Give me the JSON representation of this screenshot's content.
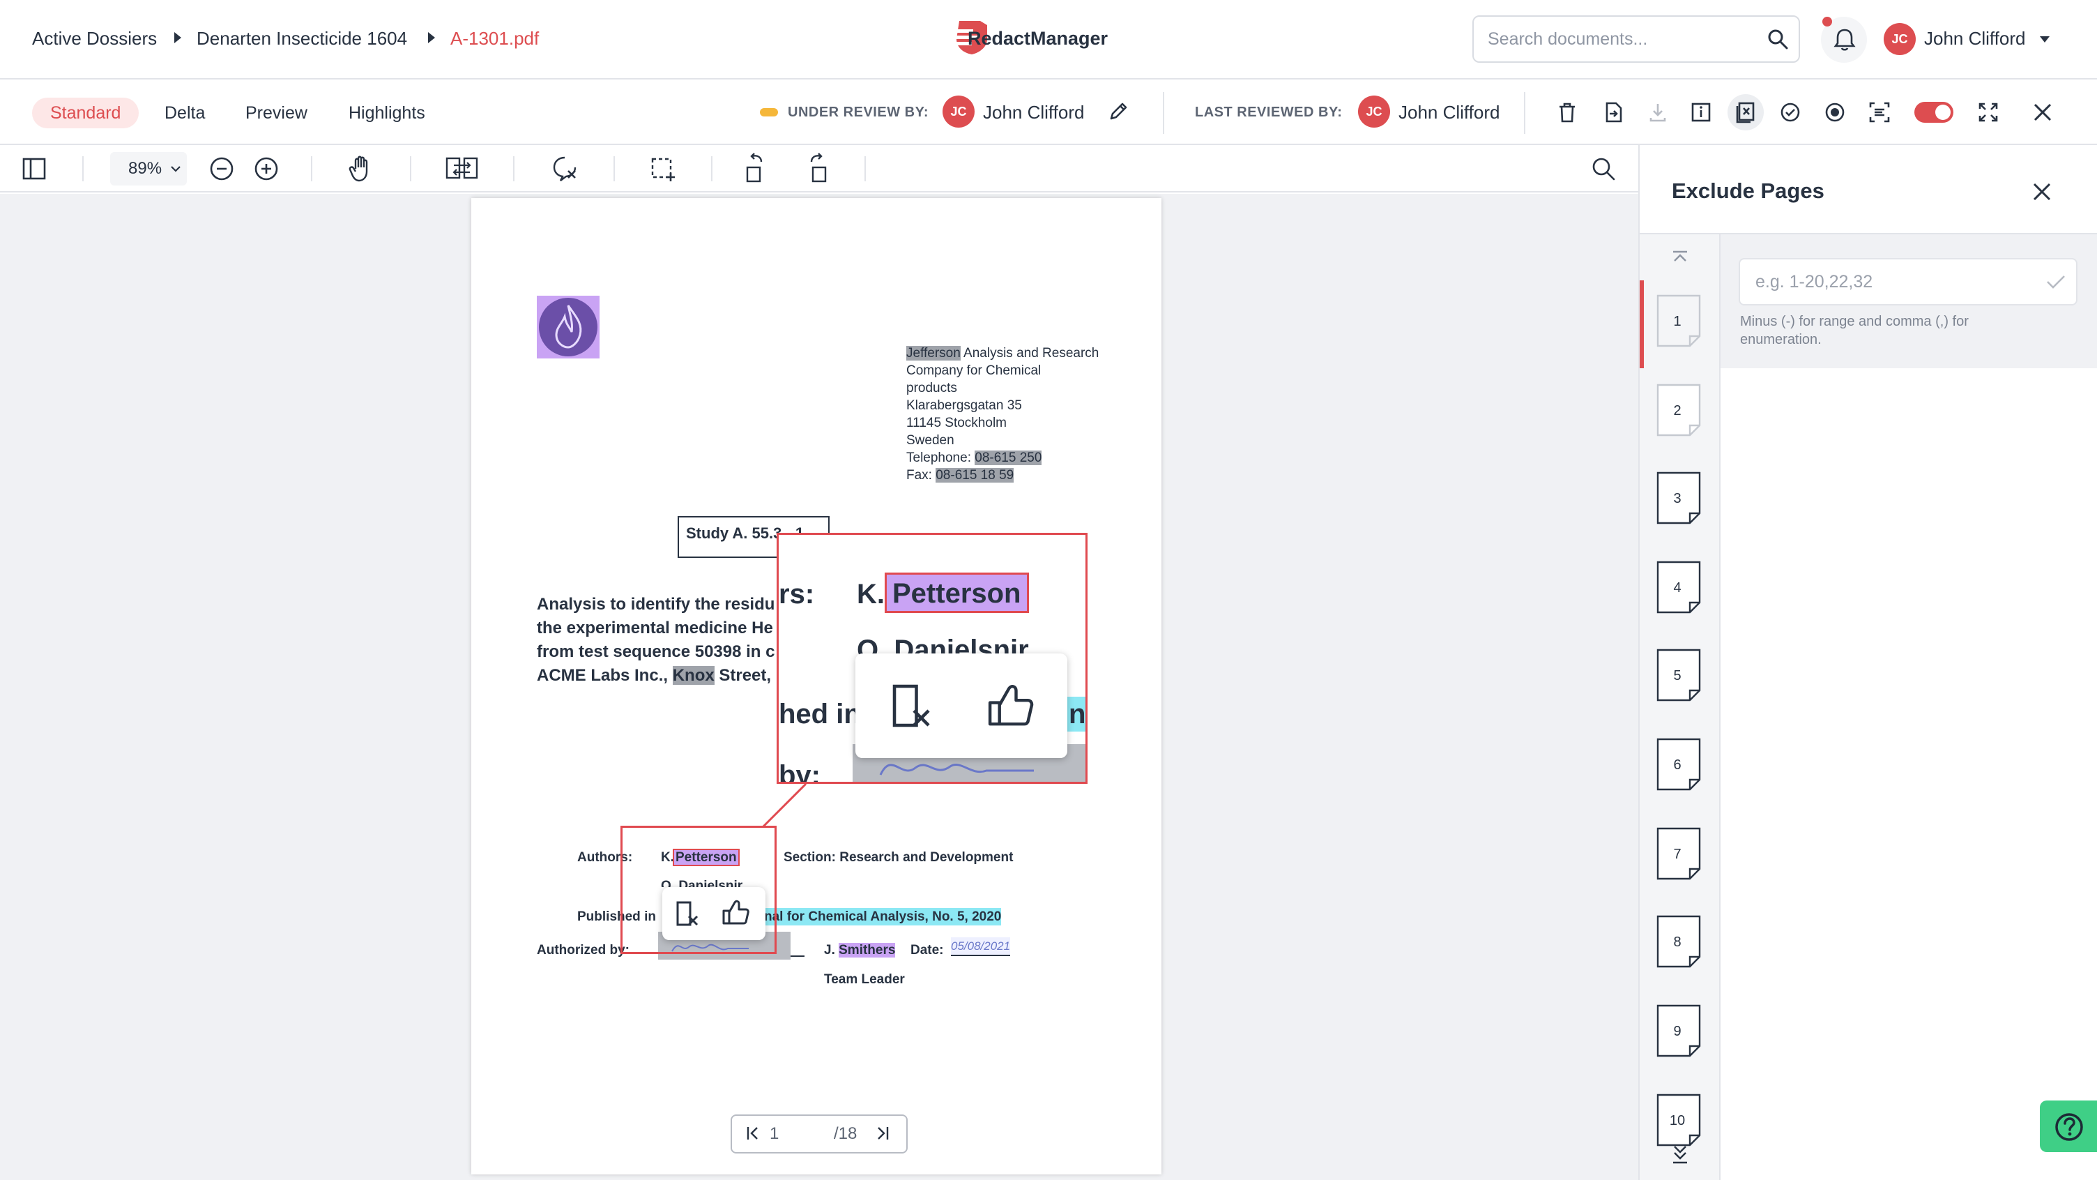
{
  "breadcrumb": {
    "items": [
      "Active Dossiers",
      "Denarten Insecticide 1604",
      "A-1301.pdf"
    ]
  },
  "brand": {
    "name": "RedactManager"
  },
  "search": {
    "placeholder": "Search documents..."
  },
  "user": {
    "initials": "JC",
    "name": "John Clifford"
  },
  "tabs": [
    {
      "label": "Standard",
      "selected": true
    },
    {
      "label": "Delta"
    },
    {
      "label": "Preview"
    },
    {
      "label": "Highlights"
    }
  ],
  "review": {
    "under_review_label": "UNDER REVIEW BY:",
    "under_review_initials": "JC",
    "under_review_name": "John Clifford",
    "last_reviewed_label": "LAST REVIEWED BY:",
    "last_reviewed_initials": "JC",
    "last_reviewed_name": "John Clifford"
  },
  "toolbar": {
    "zoom": "89%"
  },
  "document": {
    "address": {
      "line1_hl": "Jefferson",
      "line1_rest": " Analysis and Research",
      "line2": "Company for Chemical",
      "line3": "products",
      "line4": "Klarabergsgatan 35",
      "line5": "11145 Stockholm",
      "line6": "Sweden",
      "tel_label": "Telephone: ",
      "tel_value": "08-615 250",
      "fax_label": "Fax: ",
      "fax_value": "08-615 18 59"
    },
    "study_box": "Study A. 55.3 - 1",
    "analysis": {
      "line1": "Analysis to identify the residu",
      "line2": "the experimental medicine He",
      "line3": "from test sequence 50398 in c",
      "line4_a": "ACME Labs Inc., ",
      "line4_hl": "Knox",
      "line4_b": " Street, F"
    },
    "authors_label": "Authors:",
    "author1_prefix": "K.",
    "author1_hl": "Petterson",
    "author2": "O. Danielsnir",
    "section": "Section: Research and Development",
    "published_label": "Published in",
    "published_value": "nal for Chemical Analysis, No. 5, 2020",
    "authorized_label": "Authorized by:",
    "signer_prefix": "J. ",
    "signer_hl": "Smithers",
    "date_label": "Date:",
    "date_value": "05/08/2021",
    "team_leader": "Team Leader",
    "zoom_lens": {
      "label_a": "rs:",
      "prefix": "K.",
      "name": "Petterson",
      "line2": "O. Danielsnir",
      "line3": "hed in",
      "line3_hl": "n",
      "line4": "by:"
    }
  },
  "pager": {
    "current": "1",
    "total": "/18"
  },
  "panel": {
    "title": "Exclude Pages",
    "input_placeholder": "e.g. 1-20,22,32",
    "hint": "Minus (-) for range and comma (,) for enumeration.",
    "pages": [
      "1",
      "2",
      "3",
      "4",
      "5",
      "6",
      "7",
      "8",
      "9",
      "10"
    ]
  },
  "colors": {
    "accent": "#dd4d50",
    "highlight_grey": "#9fa3aa",
    "highlight_purple": "#c9a3f4",
    "highlight_cyan": "#8ce8f4",
    "help": "#3fcf86"
  }
}
